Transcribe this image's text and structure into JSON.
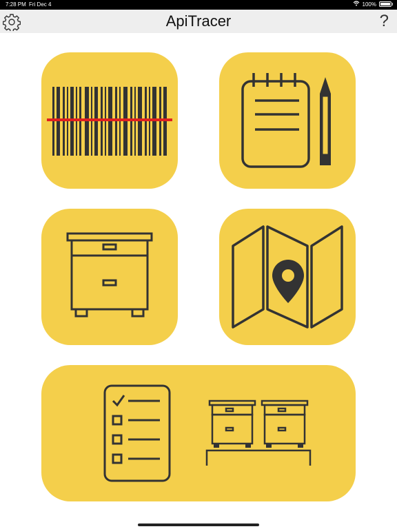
{
  "status_bar": {
    "time": "7:28 PM",
    "date": "Fri Dec 4",
    "battery": "100%"
  },
  "nav": {
    "title": "ApiTracer",
    "help_label": "?"
  },
  "tiles": [
    {
      "name": "barcode-scan",
      "icon": "barcode-icon"
    },
    {
      "name": "notes",
      "icon": "notepad-pencil-icon"
    },
    {
      "name": "hives",
      "icon": "beehive-icon"
    },
    {
      "name": "map",
      "icon": "map-pin-icon"
    },
    {
      "name": "inspection",
      "icon": "checklist-hives-icon"
    }
  ],
  "colors": {
    "tile": "#f4cf4b",
    "icon_stroke": "#333333",
    "scan_line": "#e02020",
    "nav_bg": "#eeeeee"
  }
}
